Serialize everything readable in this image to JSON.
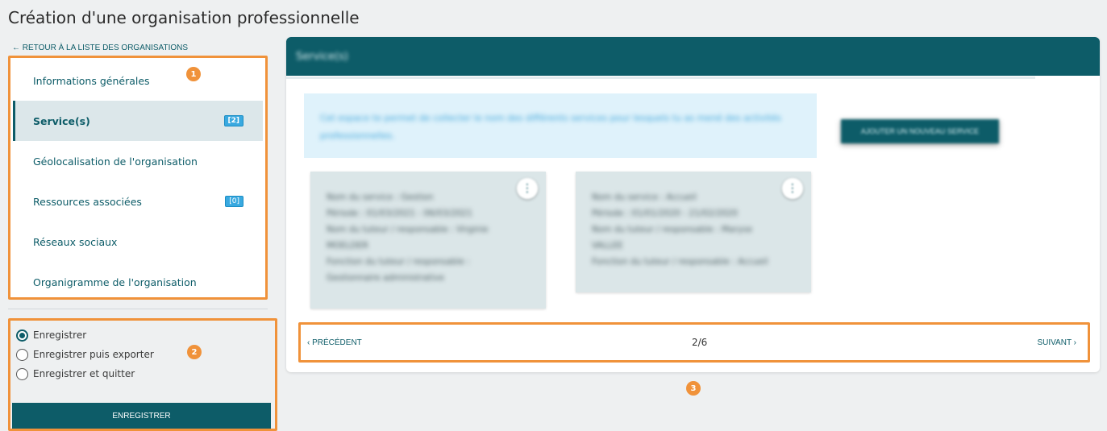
{
  "page": {
    "title": "Création d'une organisation professionnelle",
    "back_link": "← RETOUR À LA LISTE DES ORGANISATIONS"
  },
  "sidebar": {
    "items": [
      {
        "label": "Informations générales",
        "badge": null,
        "active": false
      },
      {
        "label": "Service(s)",
        "badge": "[2]",
        "active": true
      },
      {
        "label": "Géolocalisation de l'organisation",
        "badge": null,
        "active": false
      },
      {
        "label": "Ressources associées",
        "badge": "[0]",
        "active": false
      },
      {
        "label": "Réseaux sociaux",
        "badge": null,
        "active": false
      },
      {
        "label": "Organigramme de l'organisation",
        "badge": null,
        "active": false
      }
    ]
  },
  "save_options": {
    "options": [
      {
        "label": "Enregistrer",
        "checked": true
      },
      {
        "label": "Enregistrer puis exporter",
        "checked": false
      },
      {
        "label": "Enregistrer et quitter",
        "checked": false
      }
    ],
    "button_label": "ENREGISTRER"
  },
  "markers": [
    "1",
    "2",
    "3"
  ],
  "panel": {
    "header_title": "Service(s)",
    "info_text": "Cet espace te permet de collecter le nom des différents services pour lesquels tu as mené des activités professionnelles.",
    "add_button": "AJOUTER UN NOUVEAU SERVICE",
    "cards": [
      {
        "lines": [
          "Nom du service : Gestion",
          "Période : 01/03/2021 - 06/03/2021",
          "Nom du tuteur / responsable : Virginie",
          "MOELDER",
          "Fonction du tuteur / responsable :",
          "Gestionnaire administrative"
        ]
      },
      {
        "lines": [
          "Nom du service : Accueil",
          "Période : 01/01/2020 - 21/02/2020",
          "Nom du tuteur / responsable : Maryse",
          "VALLEE",
          "Fonction du tuteur / responsable : Accueil"
        ]
      }
    ]
  },
  "pager": {
    "prev": "‹ PRÉCÉDENT",
    "count": "2/6",
    "next": "SUIVANT ›"
  },
  "colors": {
    "accent": "#0d5c68",
    "highlight_outline": "#f0923a",
    "badge": "#39a9e0",
    "info_bg": "#dff2fb"
  }
}
